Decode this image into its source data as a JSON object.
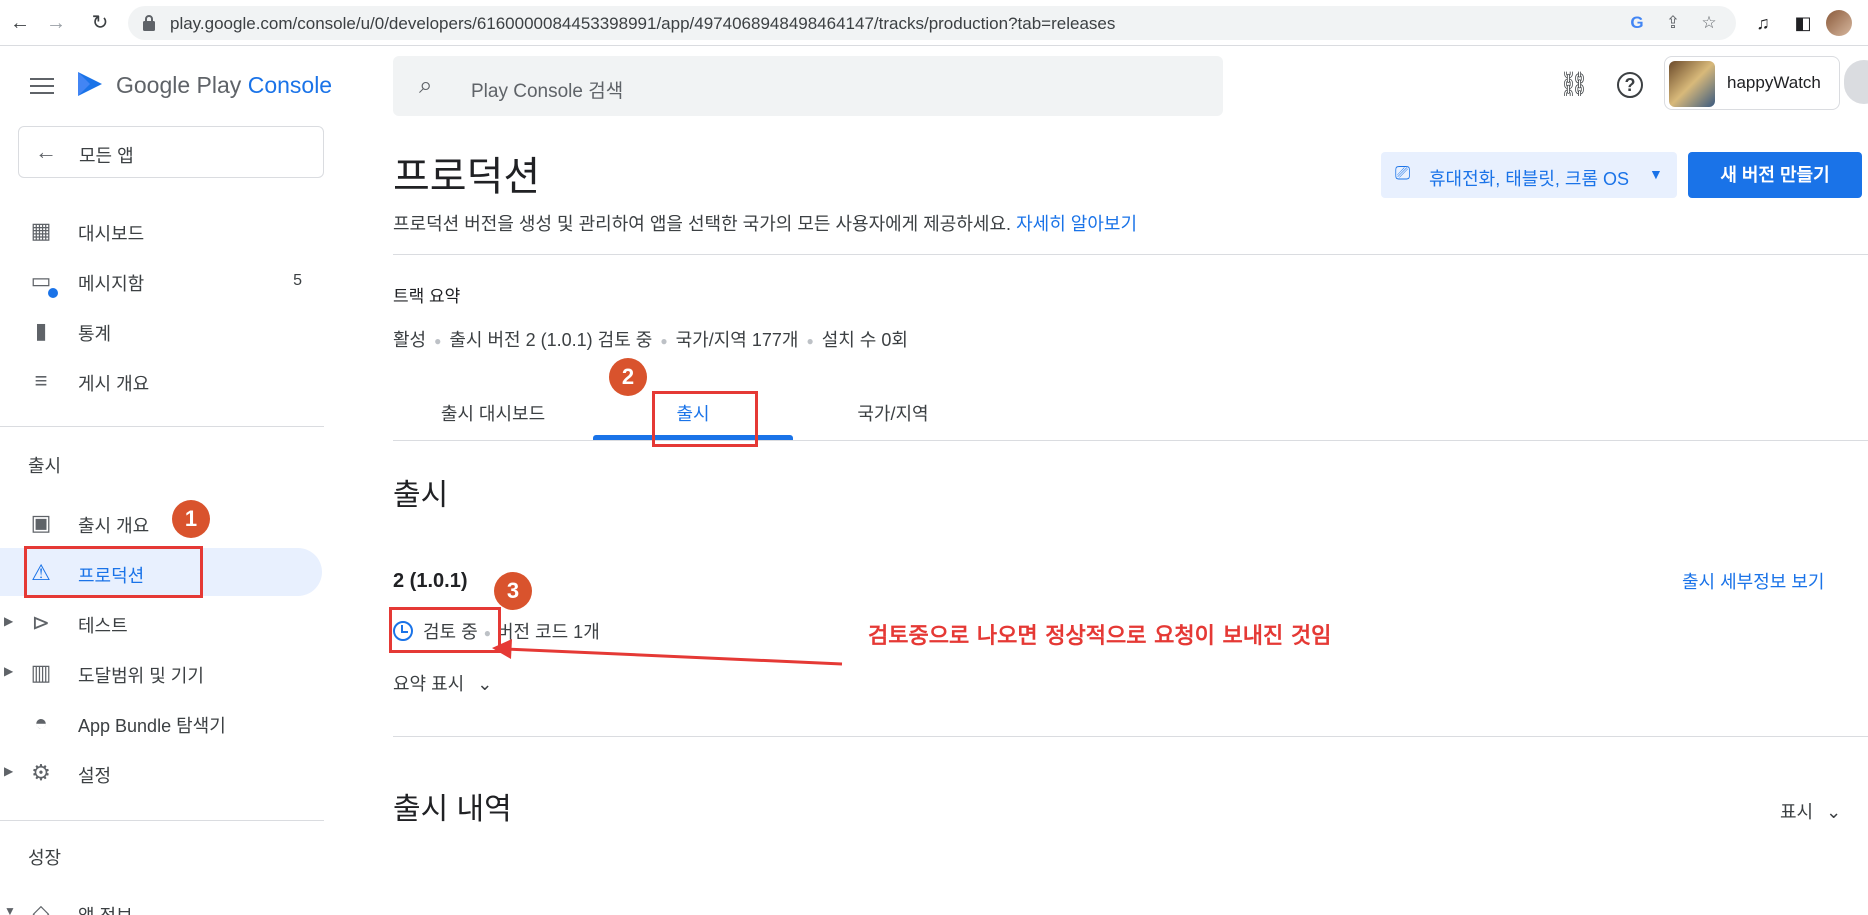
{
  "browser": {
    "url": "play.google.com/console/u/0/developers/6160000084453398991/app/4974068948498464147/tracks/production?tab=releases"
  },
  "sidebar": {
    "logo_text_main": "Google Play",
    "logo_text_accent": "Console",
    "all_apps_label": "모든 앱",
    "items": [
      {
        "label": "대시보드",
        "icon": "dashboard-icon"
      },
      {
        "label": "메시지함",
        "icon": "inbox-icon",
        "badge": "5"
      },
      {
        "label": "통계",
        "icon": "bar-chart-icon"
      },
      {
        "label": "게시 개요",
        "icon": "schedule-list-icon"
      }
    ],
    "section_release": "출시",
    "release_items": [
      {
        "label": "출시 개요",
        "icon": "grid-shapes-icon"
      },
      {
        "label": "프로덕션",
        "icon": "production-icon",
        "active": true
      },
      {
        "label": "테스트",
        "icon": "play-circle-icon"
      },
      {
        "label": "도달범위 및 기기",
        "icon": "reach-chart-icon"
      },
      {
        "label": "App Bundle 탐색기",
        "icon": "android-icon"
      },
      {
        "label": "설정",
        "icon": "gear-icon"
      }
    ],
    "section_growth": "성장",
    "growth_items": [
      {
        "label": "앱 정보",
        "icon": "store-icon"
      }
    ]
  },
  "topbar": {
    "search_placeholder": "Play Console 검색",
    "account_name": "happyWatch"
  },
  "main": {
    "title": "프로덕션",
    "description": "프로덕션 버전을 생성 및 관리하여 앱을 선택한 국가의 모든 사용자에게 제공하세요.",
    "learn_more": "자세히 알아보기",
    "device_select": "휴대전화, 태블릿, 크롬 OS",
    "create_button": "새 버전 만들기",
    "track_summary_title": "트랙 요약",
    "summary": [
      "활성",
      "출시 버전 2 (1.0.1) 검토 중",
      "국가/지역 177개",
      "설치 수 0회"
    ],
    "tabs": [
      "출시 대시보드",
      "출시",
      "국가/지역"
    ],
    "active_tab": "출시",
    "section_release": "출시",
    "release": {
      "name": "2 (1.0.1)",
      "status": "검토 중",
      "version_codes": "버전 코드 1개",
      "detail_link": "출시 세부정보 보기",
      "summary_toggle": "요약 표시"
    },
    "section_history": "출시 내역",
    "history_toggle": "표시"
  },
  "annotations": {
    "badges": [
      "1",
      "2",
      "3"
    ],
    "note": "검토중으로 나오면 정상적으로 요청이 보내진 것임",
    "color": "#e53935"
  }
}
